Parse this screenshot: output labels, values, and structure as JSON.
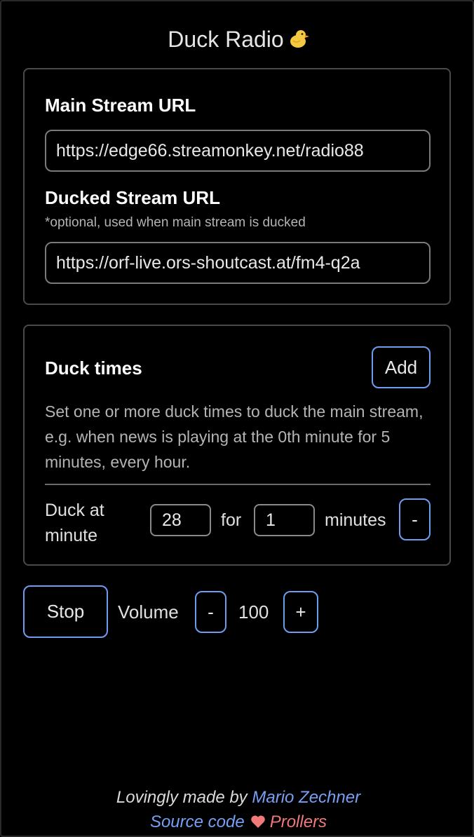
{
  "app": {
    "title": "Duck Radio",
    "icon": "duck-icon"
  },
  "streams": {
    "main_label": "Main Stream URL",
    "main_value": "https://edge66.streamonkey.net/radio88",
    "ducked_label": "Ducked Stream URL",
    "ducked_note": "*optional, used when main stream is ducked",
    "ducked_value": "https://orf-live.ors-shoutcast.at/fm4-q2a"
  },
  "duck_times": {
    "heading": "Duck times",
    "add_label": "Add",
    "description": "Set one or more duck times to duck the main stream, e.g. when news is playing at the 0th minute for 5 minutes, every hour.",
    "rows": [
      {
        "label": "Duck at minute",
        "minute": "28",
        "for_label": "for",
        "duration": "1",
        "unit_label": "minutes",
        "remove_label": "-"
      }
    ]
  },
  "controls": {
    "stop_label": "Stop",
    "volume_label": "Volume",
    "volume_down_label": "-",
    "volume_value": "100",
    "volume_up_label": "+"
  },
  "footer": {
    "made_by_text": "Lovingly made by",
    "author_link": "Mario Zechner",
    "source_link": "Source code",
    "heart_icon": "heart-icon",
    "prollers_link": "Prollers"
  },
  "colors": {
    "background": "#000000",
    "accent_border": "#6e9cf0",
    "link": "#76a0f4",
    "heart": "#f07a7a"
  }
}
